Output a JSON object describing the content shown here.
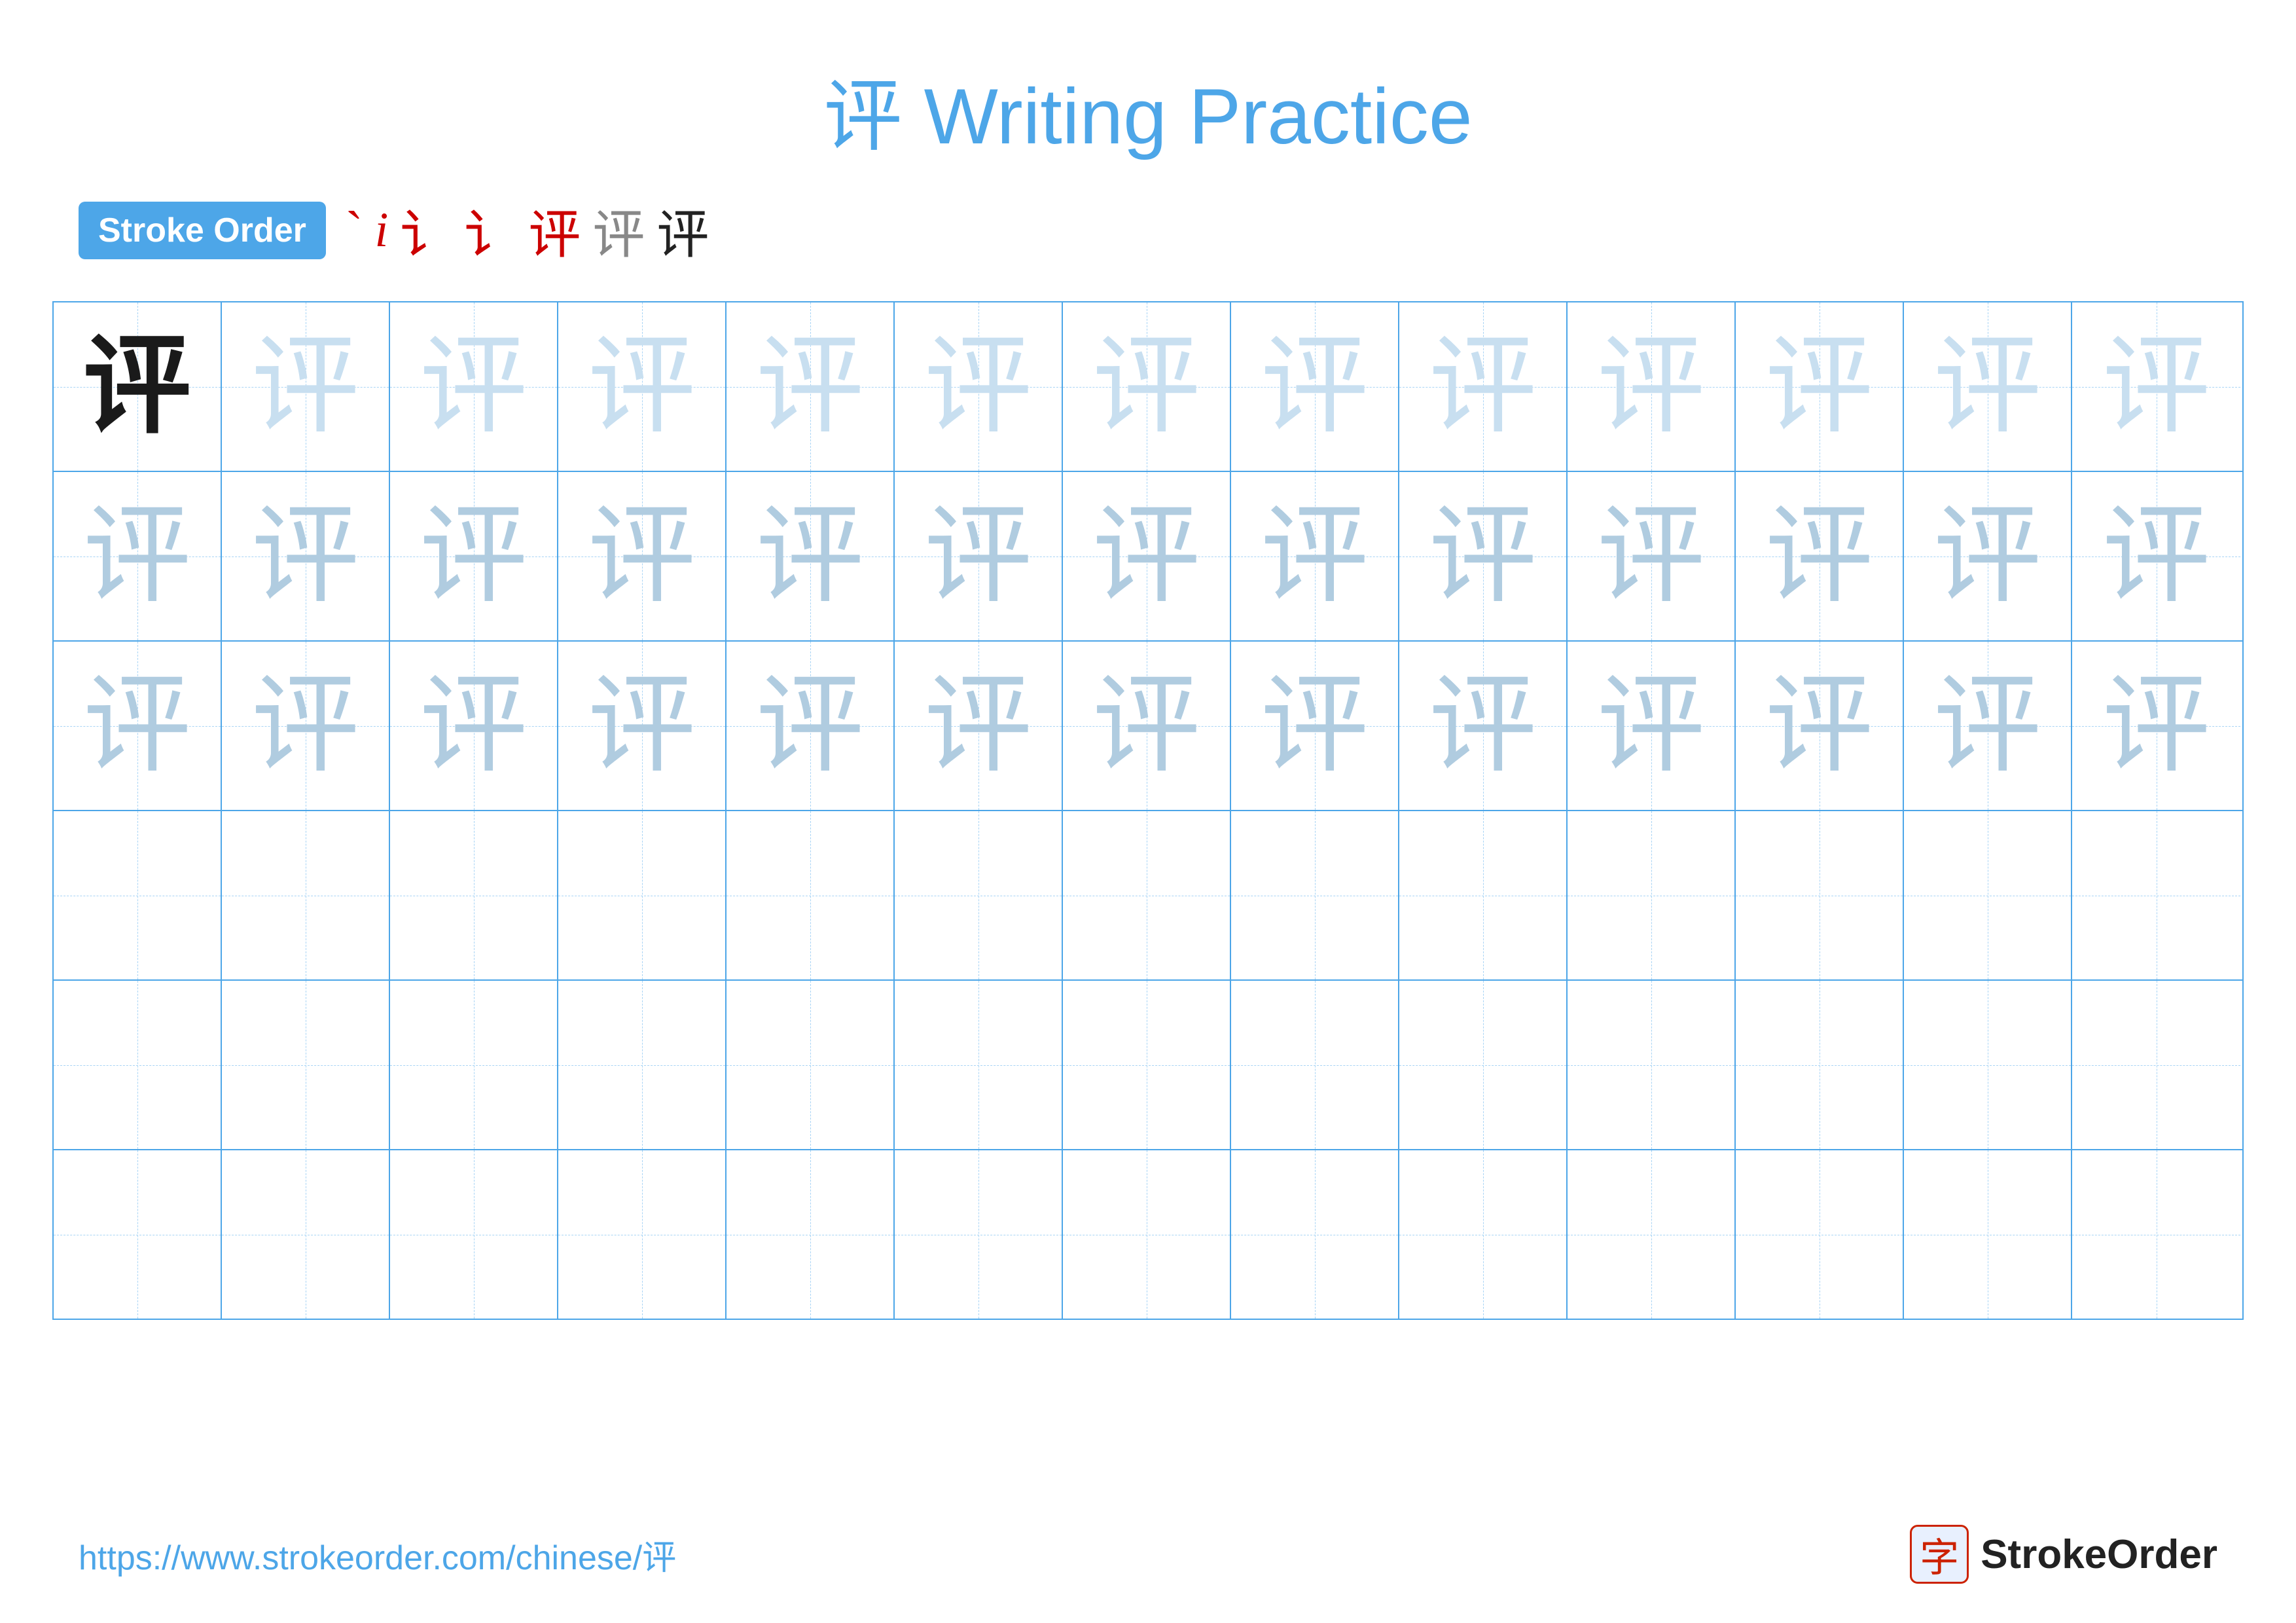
{
  "page": {
    "title": "评 Writing Practice",
    "title_char": "评",
    "title_text": " Writing Practice"
  },
  "stroke_order": {
    "badge_label": "Stroke Order",
    "strokes": [
      {
        "char": "丶",
        "style": "red"
      },
      {
        "char": "讠",
        "style": "red"
      },
      {
        "char": "讠",
        "style": "red"
      },
      {
        "char": "讠",
        "style": "red"
      },
      {
        "char": "评",
        "style": "red"
      },
      {
        "char": "评",
        "style": "gray1"
      },
      {
        "char": "评",
        "style": "dark"
      }
    ]
  },
  "grid": {
    "rows": 6,
    "cols": 13,
    "char": "评",
    "row_styles": [
      [
        "solid-dark",
        "ghost-light",
        "ghost-light",
        "ghost-light",
        "ghost-light",
        "ghost-light",
        "ghost-light",
        "ghost-light",
        "ghost-light",
        "ghost-light",
        "ghost-light",
        "ghost-light",
        "ghost-light"
      ],
      [
        "ghost-medium",
        "ghost-medium",
        "ghost-medium",
        "ghost-medium",
        "ghost-medium",
        "ghost-medium",
        "ghost-medium",
        "ghost-medium",
        "ghost-medium",
        "ghost-medium",
        "ghost-medium",
        "ghost-medium",
        "ghost-medium"
      ],
      [
        "ghost-medium",
        "ghost-medium",
        "ghost-medium",
        "ghost-medium",
        "ghost-medium",
        "ghost-medium",
        "ghost-medium",
        "ghost-medium",
        "ghost-medium",
        "ghost-medium",
        "ghost-medium",
        "ghost-medium",
        "ghost-medium"
      ],
      [
        "empty",
        "empty",
        "empty",
        "empty",
        "empty",
        "empty",
        "empty",
        "empty",
        "empty",
        "empty",
        "empty",
        "empty",
        "empty"
      ],
      [
        "empty",
        "empty",
        "empty",
        "empty",
        "empty",
        "empty",
        "empty",
        "empty",
        "empty",
        "empty",
        "empty",
        "empty",
        "empty"
      ],
      [
        "empty",
        "empty",
        "empty",
        "empty",
        "empty",
        "empty",
        "empty",
        "empty",
        "empty",
        "empty",
        "empty",
        "empty",
        "empty"
      ]
    ]
  },
  "footer": {
    "url": "https://www.strokeorder.com/chinese/评",
    "brand_icon": "字",
    "brand_name": "StrokeOrder"
  }
}
